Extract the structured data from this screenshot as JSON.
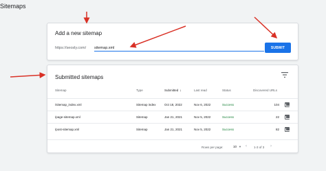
{
  "page": {
    "title": "Sitemaps"
  },
  "add_card": {
    "heading": "Add a new sitemap",
    "url_prefix": "https://seosly.com/",
    "input_value": "sitemap.xml",
    "submit_label": "SUBMIT"
  },
  "list_card": {
    "heading": "Submitted sitemaps",
    "columns": [
      "Sitemap",
      "Type",
      "Submitted",
      "Last read",
      "Status",
      "Discovered URLs"
    ],
    "sort_icon": "↓",
    "rows": [
      [
        "/sitemap_index.xml",
        "Sitemap index",
        "Oct 18, 2022",
        "Nov 6, 2022",
        "Success",
        "104"
      ],
      [
        "/page-sitemap.xml",
        "Sitemap",
        "Jan 21, 2021",
        "Nov 5, 2022",
        "Success",
        "22"
      ],
      [
        "/post-sitemap.xml",
        "Sitemap",
        "Jan 21, 2021",
        "Nov 5, 2022",
        "Success",
        "82"
      ]
    ],
    "footer": {
      "rows_per_page_label": "Rows per page:",
      "rows_per_page_value": "10",
      "range": "1-3 of 3"
    }
  },
  "colors": {
    "accent": "#1a73e8",
    "success": "#188038",
    "annotation_arrow": "#d93025"
  },
  "icons": [
    "filter-icon",
    "chart-icon",
    "chevron-left-icon",
    "chevron-right-icon",
    "dropdown-icon",
    "sort-down-icon"
  ]
}
